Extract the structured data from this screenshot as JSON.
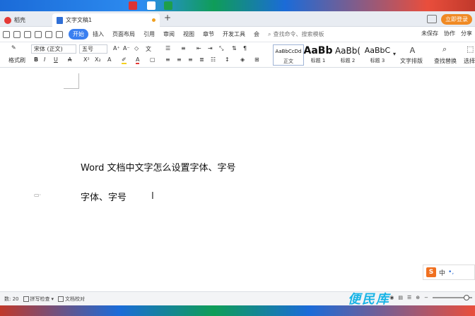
{
  "tabs": {
    "home_label": "稻壳",
    "doc_label": "文字文稿1"
  },
  "tabbar_right": {
    "login": "立即登录"
  },
  "menu": {
    "items": [
      "开始",
      "插入",
      "页面布局",
      "引用",
      "审阅",
      "视图",
      "章节",
      "开发工具",
      "会"
    ],
    "active": "开始",
    "search_placeholder": "查找命令、搜索模板",
    "right": [
      "未保存",
      "协作",
      "分享"
    ]
  },
  "ribbon": {
    "format_painter": "格式刷",
    "font_name": "宋体 (正文)",
    "font_size": "五号",
    "styles": [
      {
        "preview": "AaBbCcDd",
        "label": "正文"
      },
      {
        "preview": "AaBb",
        "label": "标题 1"
      },
      {
        "preview": "AaBb(",
        "label": "标题 2"
      },
      {
        "preview": "AaBbC",
        "label": "标题 3"
      }
    ],
    "text_layout": "文字排版",
    "find_replace": "查找替换",
    "select": "选择"
  },
  "document": {
    "line1": "Word 文档中文字怎么设置字体、字号",
    "line2": "字体、字号",
    "cursor": "I"
  },
  "ime": {
    "logo": "S",
    "mode": "中"
  },
  "status": {
    "word_count": "数: 20",
    "spell_check": "拼写检查",
    "proofread": "文档校对"
  },
  "watermark": "便民库",
  "colors": {
    "accent": "#3a7ff0",
    "login": "#f08a24",
    "watermark": "#19b4e6"
  }
}
